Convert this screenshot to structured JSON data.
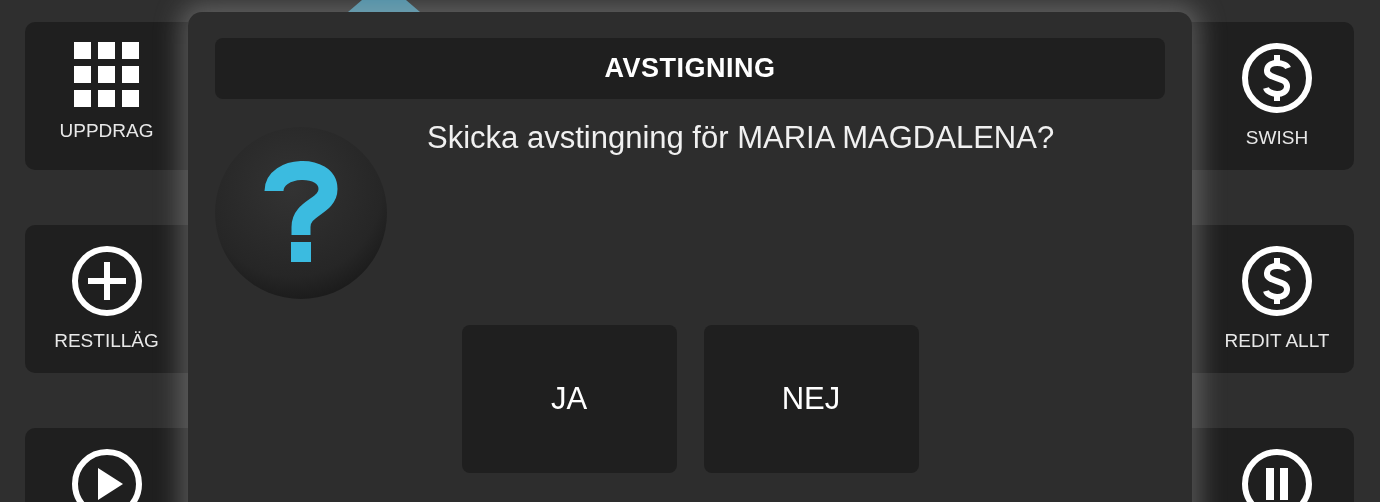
{
  "left_tiles": [
    {
      "kind": "grid",
      "label": "UPPDRAG"
    },
    {
      "kind": "plus",
      "label": "RESTILLÄG"
    },
    {
      "kind": "play"
    }
  ],
  "right_tiles": [
    {
      "kind": "dollar",
      "label": "SWISH"
    },
    {
      "kind": "dollar",
      "label": "REDIT ALLT"
    },
    {
      "kind": "pause"
    }
  ],
  "dialog": {
    "title": "AVSTIGNING",
    "message": "Skicka avstingning för MARIA MAGDALENA?",
    "buttons": [
      "JA",
      "NEJ"
    ]
  }
}
